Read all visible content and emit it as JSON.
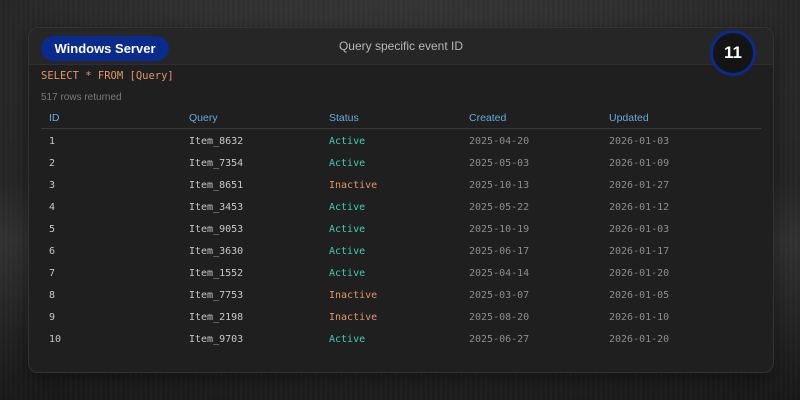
{
  "header": {
    "server_label": "Windows Server",
    "title": "Query specific event ID",
    "badge_count": "11"
  },
  "query": {
    "sql": "SELECT * FROM [Query]",
    "rows_returned": "517 rows returned"
  },
  "table": {
    "columns": [
      "ID",
      "Query",
      "Status",
      "Created",
      "Updated"
    ],
    "rows": [
      {
        "id": "1",
        "query": "Item_8632",
        "status": "Active",
        "created": "2025-04-20",
        "updated": "2026-01-03"
      },
      {
        "id": "2",
        "query": "Item_7354",
        "status": "Active",
        "created": "2025-05-03",
        "updated": "2026-01-09"
      },
      {
        "id": "3",
        "query": "Item_8651",
        "status": "Inactive",
        "created": "2025-10-13",
        "updated": "2026-01-27"
      },
      {
        "id": "4",
        "query": "Item_3453",
        "status": "Active",
        "created": "2025-05-22",
        "updated": "2026-01-12"
      },
      {
        "id": "5",
        "query": "Item_9053",
        "status": "Active",
        "created": "2025-10-19",
        "updated": "2026-01-03"
      },
      {
        "id": "6",
        "query": "Item_3630",
        "status": "Active",
        "created": "2025-06-17",
        "updated": "2026-01-17"
      },
      {
        "id": "7",
        "query": "Item_1552",
        "status": "Active",
        "created": "2025-04-14",
        "updated": "2026-01-20"
      },
      {
        "id": "8",
        "query": "Item_7753",
        "status": "Inactive",
        "created": "2025-03-07",
        "updated": "2026-01-05"
      },
      {
        "id": "9",
        "query": "Item_2198",
        "status": "Inactive",
        "created": "2025-08-20",
        "updated": "2026-01-10"
      },
      {
        "id": "10",
        "query": "Item_9703",
        "status": "Active",
        "created": "2025-06-27",
        "updated": "2026-01-20"
      }
    ]
  },
  "colors": {
    "accent": "#0a2a8c",
    "header_text": "#6aa9dc",
    "status_active": "#3fd0b0",
    "status_inactive": "#e0976a",
    "sql_text": "#e0976a"
  }
}
